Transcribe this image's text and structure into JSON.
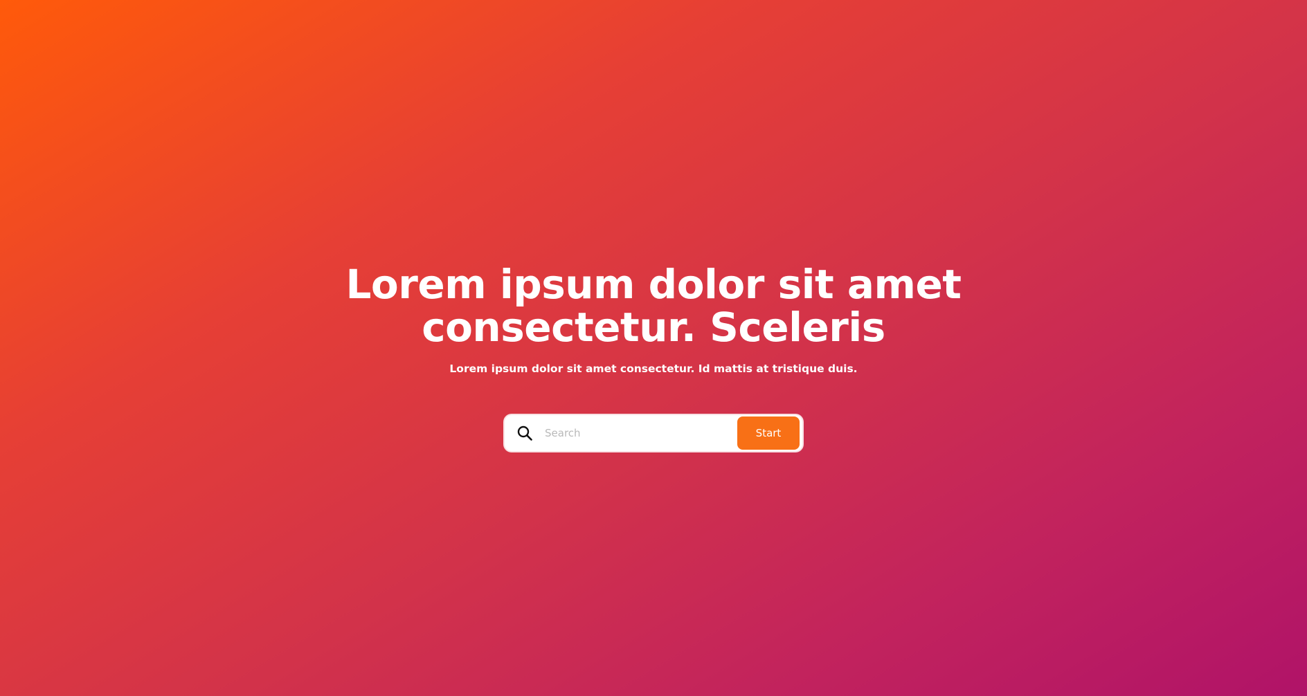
{
  "hero": {
    "headline": "Lorem ipsum dolor sit amet consectetur. Sceleris",
    "subtitle": "Lorem ipsum dolor sit amet consectetur. Id mattis at tristique duis."
  },
  "search": {
    "icon": "search-icon",
    "placeholder": "Search",
    "value": "",
    "button_label": "Start"
  },
  "colors": {
    "gradient_start": "#ff5a0a",
    "gradient_end": "#b01368",
    "button": "#f87016",
    "text": "#ffffff"
  }
}
